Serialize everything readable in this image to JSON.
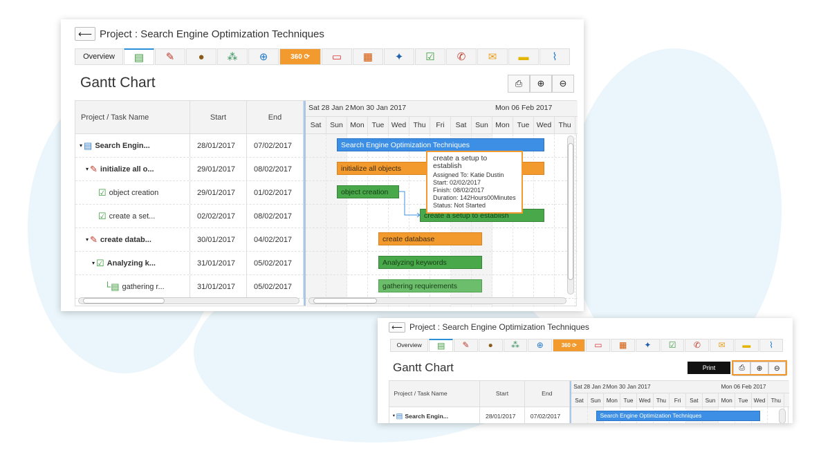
{
  "project": {
    "title": "Project : Search Engine Optimization Techniques",
    "back_icon": "back-arrow-icon"
  },
  "tabs": [
    {
      "label": "Overview",
      "icon": "overview"
    },
    {
      "label": "",
      "icon": "gantt-icon",
      "active": true
    },
    {
      "label": "",
      "icon": "task-icon"
    },
    {
      "label": "",
      "icon": "money-bag-icon"
    },
    {
      "label": "",
      "icon": "team-icon"
    },
    {
      "label": "",
      "icon": "globe-icon"
    },
    {
      "label": "360",
      "icon": "360-icon",
      "accent": "#f39a2e"
    },
    {
      "label": "",
      "icon": "bill-icon"
    },
    {
      "label": "",
      "icon": "calendar-icon"
    },
    {
      "label": "",
      "icon": "pin-icon"
    },
    {
      "label": "",
      "icon": "checklist-icon"
    },
    {
      "label": "",
      "icon": "phone-icon"
    },
    {
      "label": "",
      "icon": "mail-icon"
    },
    {
      "label": "",
      "icon": "note-icon"
    },
    {
      "label": "",
      "icon": "paperclip-icon"
    }
  ],
  "gantt": {
    "title": "Gantt Chart",
    "toolbar": [
      "print-icon",
      "zoom-in-icon",
      "zoom-out-icon"
    ],
    "columns": {
      "name": "Project / Task Name",
      "start": "Start",
      "end": "End"
    },
    "timeline_headers": {
      "week1": "Sat 28 Jan 2",
      "week2": "Mon 30 Jan 2017",
      "week3": "Mon 06 Feb 2017",
      "days": [
        "Sat",
        "Sun",
        "Mon",
        "Tue",
        "Wed",
        "Thu",
        "Fri",
        "Sat",
        "Sun",
        "Mon",
        "Tue",
        "Wed",
        "Thu"
      ]
    },
    "rows": [
      {
        "name": "Search Engin...",
        "start": "28/01/2017",
        "end": "07/02/2017",
        "bold": true,
        "indent": 0,
        "toggle": true,
        "icon": "project-icon"
      },
      {
        "name": "initialize all o...",
        "start": "29/01/2017",
        "end": "08/02/2017",
        "bold": true,
        "indent": 1,
        "toggle": true,
        "icon": "task-icon"
      },
      {
        "name": "object creation",
        "start": "29/01/2017",
        "end": "01/02/2017",
        "bold": false,
        "indent": 2,
        "toggle": false,
        "icon": "checklist-icon"
      },
      {
        "name": "create a set...",
        "start": "02/02/2017",
        "end": "08/02/2017",
        "bold": false,
        "indent": 2,
        "toggle": false,
        "icon": "checklist-icon"
      },
      {
        "name": "create datab...",
        "start": "30/01/2017",
        "end": "04/02/2017",
        "bold": true,
        "indent": 1,
        "toggle": true,
        "icon": "task-icon"
      },
      {
        "name": "Analyzing k...",
        "start": "31/01/2017",
        "end": "05/02/2017",
        "bold": true,
        "indent": 2,
        "toggle": true,
        "icon": "checklist-icon"
      },
      {
        "name": "gathering r...",
        "start": "31/01/2017",
        "end": "05/02/2017",
        "bold": false,
        "indent": 3,
        "toggle": false,
        "icon": "subtask-icon"
      }
    ],
    "bars": [
      {
        "label": "Search Engine Optimization Techniques",
        "color": "blue",
        "start_day": 1.5,
        "days": 10
      },
      {
        "label": "initialize all objects",
        "color": "orange",
        "start_day": 1.5,
        "days": 10
      },
      {
        "label": "object creation",
        "color": "green",
        "start_day": 1.5,
        "days": 3
      },
      {
        "label": "create a setup to establish",
        "color": "green",
        "start_day": 5.5,
        "days": 6
      },
      {
        "label": "create database",
        "color": "orange",
        "start_day": 3.5,
        "days": 5
      },
      {
        "label": "Analyzing keywords",
        "color": "green",
        "start_day": 3.5,
        "days": 5
      },
      {
        "label": "gathering requirements",
        "color": "lgreen",
        "start_day": 3.5,
        "days": 5
      }
    ],
    "tooltip": {
      "title": "create a setup to establish",
      "assigned": "Assigned To: Katie Dustin",
      "start": "Start: 02/02/2017",
      "finish": "Finish: 08/02/2017",
      "duration": "Duration: 142Hours00Minutes",
      "status": "Status: Not Started"
    }
  },
  "zoomed": {
    "print_tooltip": "Print"
  },
  "colors": {
    "accent": "#f39a2e",
    "bar_blue": "#3c8fe4",
    "bar_green": "#49a84a",
    "bar_orange": "#f39a2e"
  }
}
